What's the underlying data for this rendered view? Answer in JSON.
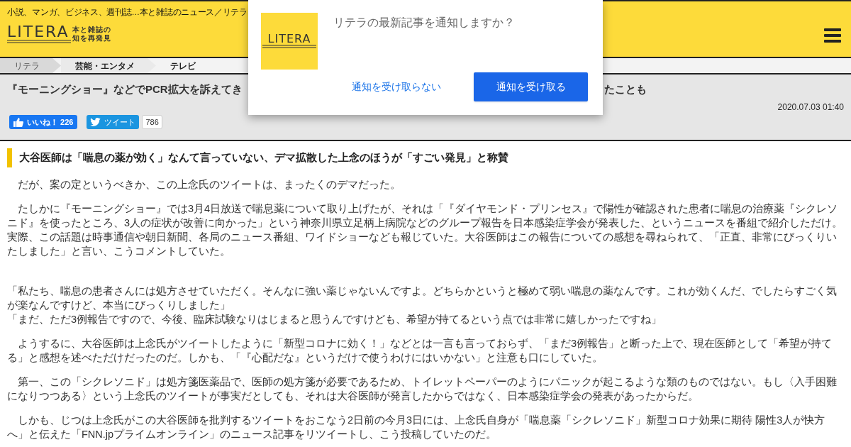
{
  "header": {
    "tagline": "小説、マンガ、ビジネス、週刊誌…本と雑誌のニュース／リテラ",
    "logo": {
      "wordmark": "LITERA",
      "subtitle_lines": [
        "本と雑誌の",
        "知を再発見"
      ]
    }
  },
  "breadcrumb": [
    "リテラ",
    "芸能・エンタメ",
    "テレビ"
  ],
  "article": {
    "title_start": "『モーニングショー』などでPCR拡大を訴えてき",
    "title_end": "たことも",
    "date": "2020.07.03 01:40",
    "like_button": {
      "label": "いいね！",
      "count": "226"
    },
    "tweet_button": {
      "label": "ツイート",
      "count": "786"
    },
    "heading": "大谷医師は「喘息の薬が効く」なんて言っていない、デマ拡散した上念のほうが「すごい発見」と称賛",
    "blocks": [
      {
        "kind": "para",
        "text": "　だが、案の定というべきか、この上念氏のツイートは、まったくのデマだった。"
      },
      {
        "kind": "para",
        "text": "　たしかに『モーニングショー』では3月4日放送で喘息薬について取り上げたが、それは「『ダイヤモンド・プリンセス』で陽性が確認された患者に喘息の治療薬『シクレソニド』を使ったところ、3人の症状が改善に向かった」という神奈川県立足柄上病院などのグループ報告を日本感染症学会が発表した、というニュースを番組で紹介しただけ。実際、この話題は時事通信や朝日新聞、各局のニュース番組、ワイドショーなども報じていた。大谷医師はこの報告についての感想を尋ねられて、「正直、非常にびっくりいたしました」と言い、こうコメントしていた。"
      },
      {
        "kind": "quote",
        "lines": [
          "「私たち、喘息の患者さんには処方させていただく。そんなに強い薬じゃないんですよ。どちらかというと極めて弱い喘息の薬なんです。これが効くんだ、でしたらすごく気が楽なんですけど、本当にびっくりしました」",
          "「まだ、ただ3例報告ですので、今後、臨床試験なりはじまると思うんですけども、希望が持てるという点では非常に嬉しかったですね」"
        ]
      },
      {
        "kind": "para",
        "text": "　ようするに、大谷医師は上念氏がツイートしたように「新型コロナに効く！」などとは一言も言っておらず、「まだ3例報告」と断った上で、現在医師として「希望が持てる」と感想を述べただけだったのだ。しかも、「『心配だな』というだけで使うわけにはいかない」と注意も口にしていた。"
      },
      {
        "kind": "para",
        "text": "　第一、この「シクレソニド」は処方箋医薬品で、医師の処方箋が必要であるため、トイレットペーパーのようにパニックが起こるような類のものではない。もし〈入手困難になりつつある〉という上念氏のツイートが事実だとしても、それは大谷医師が発言したからではなく、日本感染症学会の発表があったからだ。"
      },
      {
        "kind": "para",
        "text": "　しかも、じつは上念氏がこの大谷医師を批判するツイートをおこなう2日前の今月3日には、上念氏自身が「喘息薬「シクレソニド」新型コロナ効果に期待 陽性3人が快方へ」と伝えた「FNN.jpプライムオンライン」のニュース記事をリツイートし、こう投稿していたのだ。"
      }
    ]
  },
  "notification_dialog": {
    "logo_wordmark": "LITERA",
    "message": "リテラの最新記事を通知しますか？",
    "decline_button": "通知を受け取らない",
    "accept_button": "通知を受け取る"
  }
}
